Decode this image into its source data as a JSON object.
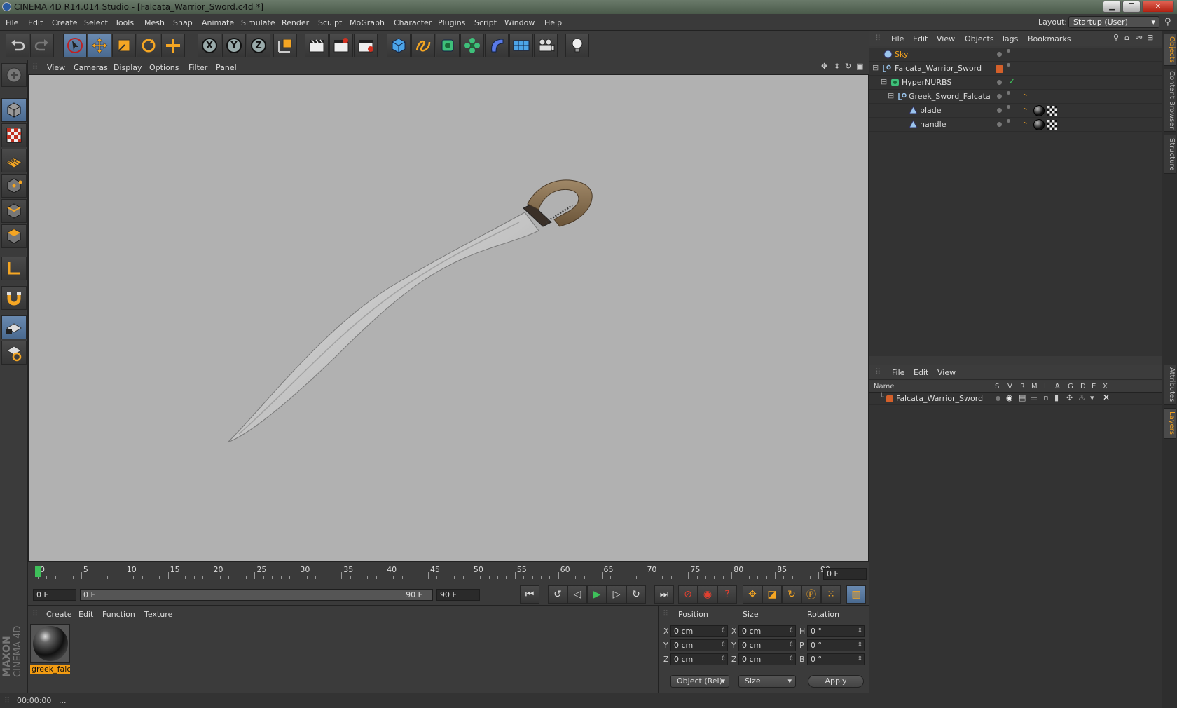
{
  "window": {
    "title": "CINEMA 4D R14.014 Studio - [Falcata_Warrior_Sword.c4d *]"
  },
  "menubar": {
    "items": [
      "File",
      "Edit",
      "Create",
      "Select",
      "Tools",
      "Mesh",
      "Snap",
      "Animate",
      "Simulate",
      "Render",
      "Sculpt",
      "MoGraph",
      "Character",
      "Plugins",
      "Script",
      "Window",
      "Help"
    ],
    "layout_label": "Layout:",
    "layout_value": "Startup (User)"
  },
  "toolbar": {
    "axis_x": "X",
    "axis_y": "Y",
    "axis_z": "Z"
  },
  "viewport": {
    "menu": [
      "View",
      "Cameras",
      "Display",
      "Options",
      "Filter",
      "Panel"
    ]
  },
  "timeline": {
    "ticks": [
      "0",
      "5",
      "10",
      "15",
      "20",
      "25",
      "30",
      "35",
      "40",
      "45",
      "50",
      "55",
      "60",
      "65",
      "70",
      "75",
      "80",
      "85",
      "90"
    ],
    "current_frame": "0 F",
    "start_field": "0 F",
    "range_start": "0 F",
    "range_end": "90 F",
    "end_field": "90 F"
  },
  "material_manager": {
    "menu": [
      "Create",
      "Edit",
      "Function",
      "Texture"
    ],
    "materials": [
      {
        "name": "greek_falca"
      }
    ]
  },
  "coordinates": {
    "headers": {
      "position": "Position",
      "size": "Size",
      "rotation": "Rotation"
    },
    "position": {
      "x_label": "X",
      "y_label": "Y",
      "z_label": "Z",
      "x": "0 cm",
      "y": "0 cm",
      "z": "0 cm"
    },
    "size": {
      "x_label": "X",
      "y_label": "Y",
      "z_label": "Z",
      "x": "0 cm",
      "y": "0 cm",
      "z": "0 cm"
    },
    "rotation": {
      "h_label": "H",
      "p_label": "P",
      "b_label": "B",
      "h": "0 °",
      "p": "0 °",
      "b": "0 °"
    },
    "mode": "Object (Rel)",
    "size_mode": "Size",
    "apply": "Apply"
  },
  "statusbar": {
    "time": "00:00:00",
    "message": "..."
  },
  "object_manager": {
    "menu": [
      "File",
      "Edit",
      "View",
      "Objects",
      "Tags",
      "Bookmarks"
    ],
    "objects": [
      {
        "name": "Sky",
        "type": "sky"
      },
      {
        "name": "Falcata_Warrior_Sword",
        "type": "null"
      },
      {
        "name": "HyperNURBS",
        "type": "hypernurbs"
      },
      {
        "name": "Greek_Sword_Falcata",
        "type": "null"
      },
      {
        "name": "blade",
        "type": "polygon"
      },
      {
        "name": "handle",
        "type": "polygon"
      }
    ]
  },
  "layer_manager": {
    "menu": [
      "File",
      "Edit",
      "View"
    ],
    "columns": [
      "Name",
      "S",
      "V",
      "R",
      "M",
      "L",
      "A",
      "G",
      "D",
      "E",
      "X"
    ],
    "layers": [
      {
        "name": "Falcata_Warrior_Sword",
        "color": "#d4602a"
      }
    ]
  },
  "side_tabs": [
    "Objects",
    "Content Browser",
    "Structure",
    "Attributes",
    "Layers"
  ],
  "colors": {
    "accent": "#f39c12",
    "selection": "#5a7aa0",
    "play": "#3ec05a",
    "layer": "#d4602a"
  }
}
